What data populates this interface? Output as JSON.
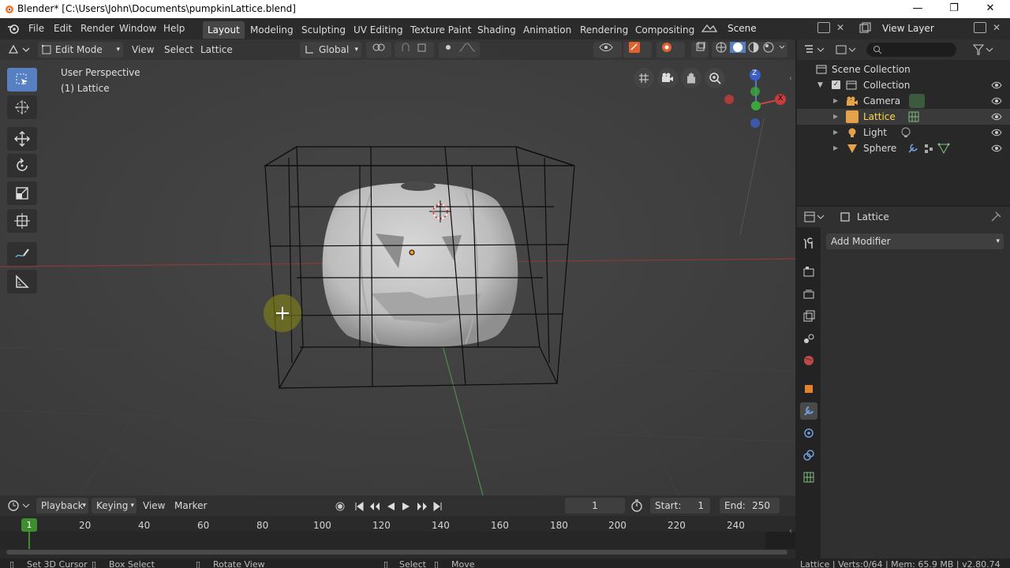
{
  "window": {
    "title": "Blender* [C:\\Users\\John\\Documents\\pumpkinLattice.blend]",
    "minimize": "—",
    "maximize": "❐",
    "close": "✕"
  },
  "menu": {
    "items": [
      "File",
      "Edit",
      "Render",
      "Window",
      "Help"
    ],
    "workspaces": [
      "Layout",
      "Modeling",
      "Sculpting",
      "UV Editing",
      "Texture Paint",
      "Shading",
      "Animation",
      "Rendering",
      "Compositing"
    ],
    "active_workspace": "Layout",
    "scene": "Scene",
    "view_layer": "View Layer"
  },
  "viewport": {
    "mode": "Edit Mode",
    "menus": [
      "View",
      "Select",
      "Lattice"
    ],
    "orientation": "Global",
    "info_line1": "User Perspective",
    "info_line2": "(1) Lattice",
    "gizmo_x": "X",
    "gizmo_z": "Z"
  },
  "outliner": {
    "root": "Scene Collection",
    "collection": "Collection",
    "objects": [
      {
        "name": "Camera",
        "icon": "camera-icon",
        "color": "#d9d9d9"
      },
      {
        "name": "Lattice",
        "icon": "lattice-icon",
        "color": "#ffd84a"
      },
      {
        "name": "Light",
        "icon": "light-icon",
        "color": "#d9d9d9"
      },
      {
        "name": "Sphere",
        "icon": "mesh-icon",
        "color": "#d9d9d9"
      }
    ]
  },
  "properties": {
    "object_name": "Lattice",
    "add_modifier": "Add Modifier"
  },
  "timeline": {
    "menus": [
      "Playback",
      "Keying",
      "View",
      "Marker"
    ],
    "current_frame": "1",
    "start_label": "Start:",
    "start": "1",
    "end_label": "End:",
    "end": "250",
    "frame_marker": "1",
    "ticks": [
      "20",
      "40",
      "60",
      "80",
      "100",
      "120",
      "140",
      "160",
      "180",
      "200",
      "220",
      "240"
    ]
  },
  "statusbar": {
    "set_cursor": "Set 3D Cursor",
    "box_select": "Box Select",
    "rotate_view": "Rotate View",
    "select": "Select",
    "move": "Move",
    "stats": "Lattice | Verts:0/64 | Mem: 65.9 MB | v2.80.74"
  },
  "colors": {
    "accent": "#5680c2",
    "selected_object": "#ffd84a",
    "frame_green": "#3e8e2f"
  }
}
